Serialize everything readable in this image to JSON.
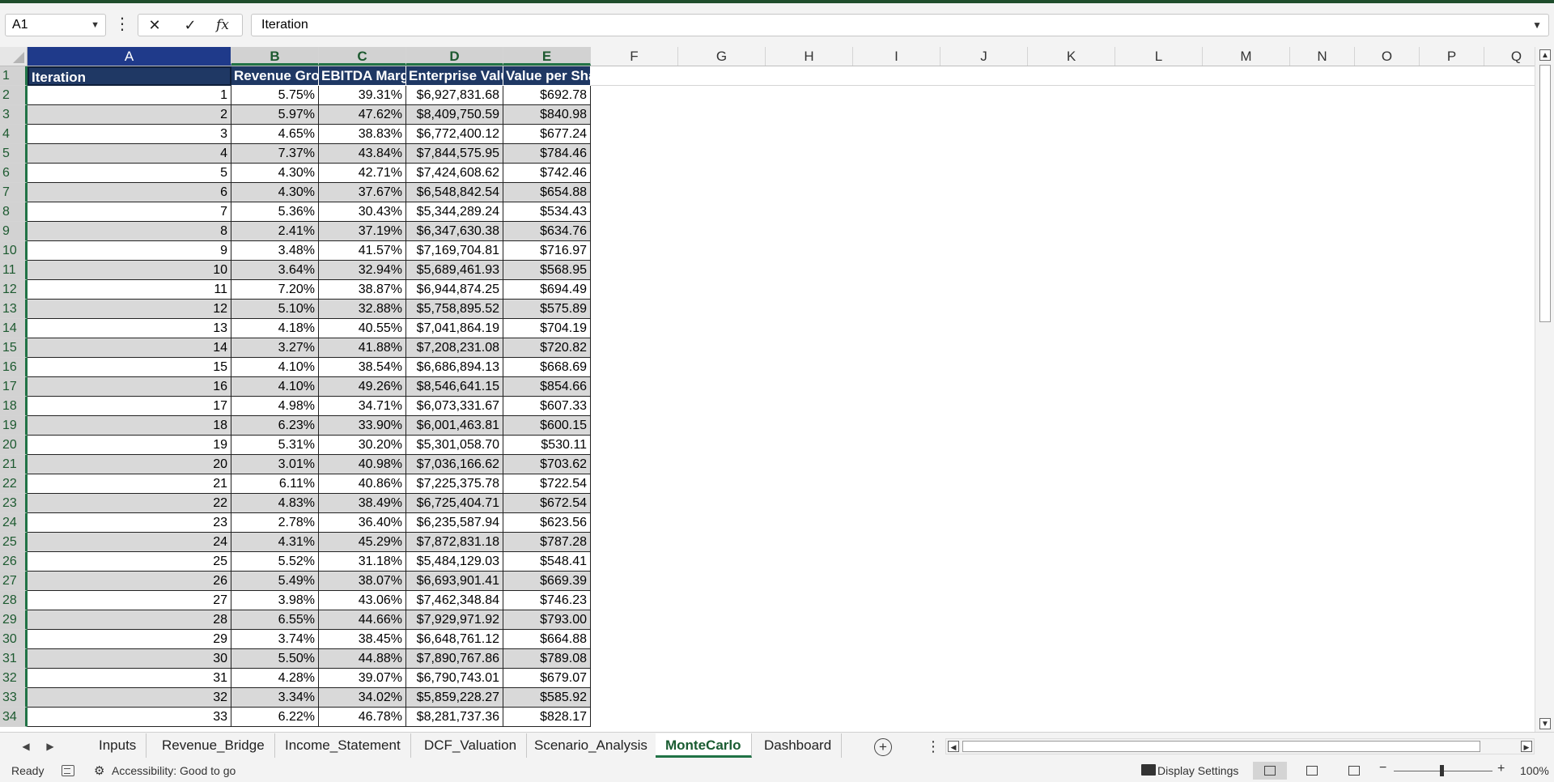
{
  "formula_bar": {
    "name_box": "A1",
    "cancel_icon": "✕",
    "enter_icon": "✓",
    "function_icon": "fx",
    "formula": "Iteration"
  },
  "columns": [
    "A",
    "B",
    "C",
    "D",
    "E",
    "F",
    "G",
    "H",
    "I",
    "J",
    "K",
    "L",
    "M",
    "N",
    "O",
    "P",
    "Q"
  ],
  "headers": [
    "Iteration",
    "Revenue Growth",
    "EBITDA Margin",
    "Enterprise Value",
    "Value per Share"
  ],
  "rows": [
    [
      "1",
      "5.75%",
      "39.31%",
      "$6,927,831.68",
      "$692.78"
    ],
    [
      "2",
      "5.97%",
      "47.62%",
      "$8,409,750.59",
      "$840.98"
    ],
    [
      "3",
      "4.65%",
      "38.83%",
      "$6,772,400.12",
      "$677.24"
    ],
    [
      "4",
      "7.37%",
      "43.84%",
      "$7,844,575.95",
      "$784.46"
    ],
    [
      "5",
      "4.30%",
      "42.71%",
      "$7,424,608.62",
      "$742.46"
    ],
    [
      "6",
      "4.30%",
      "37.67%",
      "$6,548,842.54",
      "$654.88"
    ],
    [
      "7",
      "5.36%",
      "30.43%",
      "$5,344,289.24",
      "$534.43"
    ],
    [
      "8",
      "2.41%",
      "37.19%",
      "$6,347,630.38",
      "$634.76"
    ],
    [
      "9",
      "3.48%",
      "41.57%",
      "$7,169,704.81",
      "$716.97"
    ],
    [
      "10",
      "3.64%",
      "32.94%",
      "$5,689,461.93",
      "$568.95"
    ],
    [
      "11",
      "7.20%",
      "38.87%",
      "$6,944,874.25",
      "$694.49"
    ],
    [
      "12",
      "5.10%",
      "32.88%",
      "$5,758,895.52",
      "$575.89"
    ],
    [
      "13",
      "4.18%",
      "40.55%",
      "$7,041,864.19",
      "$704.19"
    ],
    [
      "14",
      "3.27%",
      "41.88%",
      "$7,208,231.08",
      "$720.82"
    ],
    [
      "15",
      "4.10%",
      "38.54%",
      "$6,686,894.13",
      "$668.69"
    ],
    [
      "16",
      "4.10%",
      "49.26%",
      "$8,546,641.15",
      "$854.66"
    ],
    [
      "17",
      "4.98%",
      "34.71%",
      "$6,073,331.67",
      "$607.33"
    ],
    [
      "18",
      "6.23%",
      "33.90%",
      "$6,001,463.81",
      "$600.15"
    ],
    [
      "19",
      "5.31%",
      "30.20%",
      "$5,301,058.70",
      "$530.11"
    ],
    [
      "20",
      "3.01%",
      "40.98%",
      "$7,036,166.62",
      "$703.62"
    ],
    [
      "21",
      "6.11%",
      "40.86%",
      "$7,225,375.78",
      "$722.54"
    ],
    [
      "22",
      "4.83%",
      "38.49%",
      "$6,725,404.71",
      "$672.54"
    ],
    [
      "23",
      "2.78%",
      "36.40%",
      "$6,235,587.94",
      "$623.56"
    ],
    [
      "24",
      "4.31%",
      "45.29%",
      "$7,872,831.18",
      "$787.28"
    ],
    [
      "25",
      "5.52%",
      "31.18%",
      "$5,484,129.03",
      "$548.41"
    ],
    [
      "26",
      "5.49%",
      "38.07%",
      "$6,693,901.41",
      "$669.39"
    ],
    [
      "27",
      "3.98%",
      "43.06%",
      "$7,462,348.84",
      "$746.23"
    ],
    [
      "28",
      "6.55%",
      "44.66%",
      "$7,929,971.92",
      "$793.00"
    ],
    [
      "29",
      "3.74%",
      "38.45%",
      "$6,648,761.12",
      "$664.88"
    ],
    [
      "30",
      "5.50%",
      "44.88%",
      "$7,890,767.86",
      "$789.08"
    ],
    [
      "31",
      "4.28%",
      "39.07%",
      "$6,790,743.01",
      "$679.07"
    ],
    [
      "32",
      "3.34%",
      "34.02%",
      "$5,859,228.27",
      "$585.92"
    ],
    [
      "33",
      "6.22%",
      "46.78%",
      "$8,281,737.36",
      "$828.17"
    ]
  ],
  "sheet_tabs": [
    "Inputs",
    "Revenue_Bridge",
    "Income_Statement",
    "DCF_Valuation",
    "Scenario_Analysis",
    "MonteCarlo",
    "Dashboard"
  ],
  "active_sheet": "MonteCarlo",
  "status": {
    "ready": "Ready",
    "accessibility": "Accessibility: Good to go",
    "display_settings": "Display Settings",
    "zoom": "100%"
  },
  "colors": {
    "header_fill": "#1f3864",
    "band_fill": "#d9d9d9",
    "excel_green": "#217346"
  },
  "icons": [
    "name-box-dropdown-icon",
    "more-options-icon",
    "cancel-icon",
    "enter-icon",
    "function-icon",
    "formula-expand-icon",
    "select-all-icon",
    "scroll-left-icon",
    "scroll-right-icon",
    "add-sheet-icon",
    "macro-icon",
    "accessibility-icon",
    "display-settings-icon",
    "normal-view-icon",
    "page-layout-icon",
    "page-break-icon",
    "zoom-minus-icon",
    "zoom-plus-icon"
  ]
}
